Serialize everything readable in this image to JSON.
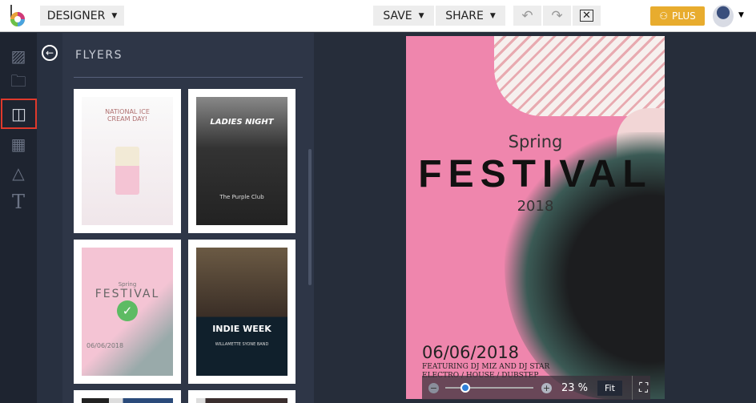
{
  "header": {
    "designer": "DESIGNER",
    "save": "SAVE",
    "share": "SHARE",
    "plus": "PLUS"
  },
  "panel": {
    "title": "FLYERS"
  },
  "templates": [
    {
      "title": "NATIONAL ICE CREAM DAY!"
    },
    {
      "title": "LADIES NIGHT",
      "sub": "The Purple Club"
    },
    {
      "title": "FESTIVAL",
      "pre": "Spring",
      "date": "06/06/2018"
    },
    {
      "title": "INDIE WEEK",
      "sub": "WILLAMETTE SYONE BAND"
    }
  ],
  "flyer": {
    "spring": "Spring",
    "festival": "FESTIVAL",
    "year": "2018",
    "date": "06/06/2018",
    "featuring": "FEATURING DJ MIZ AND DJ STAR",
    "genres": "ELECTRO / HOUSE / DUBSTEP"
  },
  "zoom": {
    "percent": "23 %",
    "fit": "Fit",
    "value": 23
  }
}
